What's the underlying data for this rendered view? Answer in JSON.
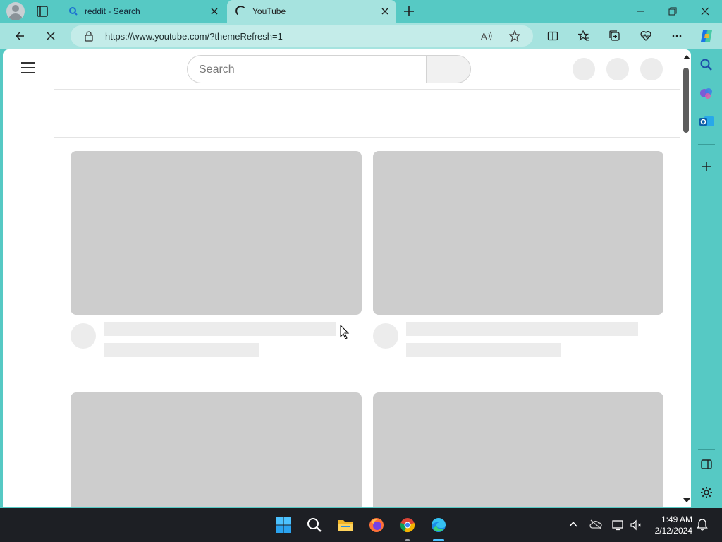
{
  "browser": {
    "tabs": [
      {
        "title": "reddit - Search",
        "favicon": "search-icon",
        "active": false
      },
      {
        "title": "YouTube",
        "favicon": "loading-spinner-icon",
        "active": true
      }
    ],
    "address": "https://www.youtube.com/?themeRefresh=1",
    "toolbar_icons": [
      "back-icon",
      "stop-loading-icon",
      "site-info-icon",
      "read-aloud-icon",
      "add-favorite-icon",
      "split-screen-icon",
      "favorites-icon",
      "collections-icon",
      "browser-essentials-icon",
      "more-icon",
      "copilot-icon"
    ],
    "sidebar_icons": [
      "search-icon",
      "copilot-icon",
      "outlook-icon",
      "add-icon",
      "hide-sidebar-icon",
      "settings-icon"
    ],
    "accent_color": "#56c9c4"
  },
  "page": {
    "search_placeholder": "Search",
    "state": "loading skeleton",
    "skeleton_fill": "#cdcdcd"
  },
  "taskbar": {
    "time": "1:49 AM",
    "date": "2/12/2024",
    "apps": [
      "start-icon",
      "search-icon",
      "file-explorer-icon",
      "firefox-icon",
      "chrome-icon",
      "edge-icon"
    ],
    "tray": [
      "chevron-up-icon",
      "onedrive-icon",
      "display-icon",
      "volume-muted-icon",
      "notification-bell-icon"
    ]
  }
}
